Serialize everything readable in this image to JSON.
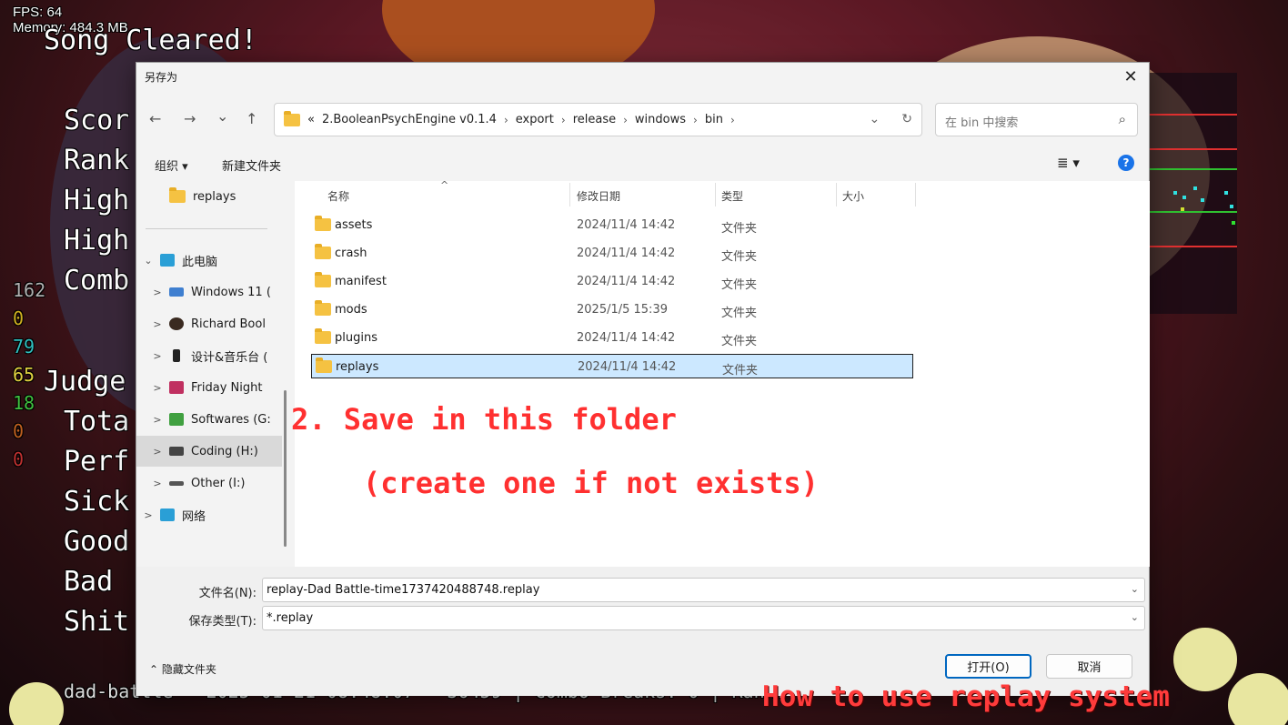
{
  "game": {
    "fps": "FPS: 64",
    "memory": "Memory: 484.3 MB",
    "song_cleared": "Song Cleared!",
    "stats": [
      "Scor",
      "Rank",
      "High",
      "High",
      "Comb"
    ],
    "numbers": [
      "162",
      "0",
      "79",
      "65",
      "18",
      "0",
      "0"
    ],
    "judge_title": "Judge",
    "judge_stats": [
      "Tota",
      "Perf",
      "Sick",
      "Good",
      "Bad",
      "Shit"
    ],
    "footer_text": "dad-battle - 2025-01-21 08:48:07 - 36459 | Combo Breaks: 0 | Rank:",
    "tutorial_title": "How to use replay system"
  },
  "dialog": {
    "title": "另存为",
    "close_label": "✕",
    "nav": {
      "back": "←",
      "forward": "→",
      "recent": "⌄",
      "up": "↑"
    },
    "breadcrumb": {
      "prefix": "«",
      "items": [
        "2.BooleanPsychEngine v0.1.4",
        "export",
        "release",
        "windows",
        "bin"
      ]
    },
    "search_placeholder": "在 bin 中搜索",
    "toolbar": {
      "organize": "组织 ▾",
      "new_folder": "新建文件夹",
      "view": "≣ ▾",
      "help": "?"
    },
    "nav_pane": [
      {
        "label": "replays",
        "icon": "folder-icon",
        "chevron": ""
      },
      {
        "label": "此电脑",
        "icon": "computer-icon",
        "chevron": "⌄"
      },
      {
        "label": "Windows 11 (",
        "icon": "drive-icon",
        "chevron": ">"
      },
      {
        "label": "Richard Bool",
        "icon": "user-avatar-icon",
        "chevron": ">"
      },
      {
        "label": "设计&音乐台 (",
        "icon": "drive-icon",
        "chevron": ">"
      },
      {
        "label": "Friday Night",
        "icon": "game-icon",
        "chevron": ">"
      },
      {
        "label": "Softwares (G:",
        "icon": "drive-icon",
        "chevron": ">"
      },
      {
        "label": "Coding (H:)",
        "icon": "drive-icon",
        "chevron": ">"
      },
      {
        "label": "Other (I:)",
        "icon": "drive-icon",
        "chevron": ">"
      },
      {
        "label": "网络",
        "icon": "network-icon",
        "chevron": ">"
      }
    ],
    "columns": {
      "name": "名称",
      "date": "修改日期",
      "type": "类型",
      "size": "大小"
    },
    "files": [
      {
        "name": "assets",
        "date": "2024/11/4 14:42",
        "type": "文件夹"
      },
      {
        "name": "crash",
        "date": "2024/11/4 14:42",
        "type": "文件夹"
      },
      {
        "name": "manifest",
        "date": "2024/11/4 14:42",
        "type": "文件夹"
      },
      {
        "name": "mods",
        "date": "2025/1/5 15:39",
        "type": "文件夹"
      },
      {
        "name": "plugins",
        "date": "2024/11/4 14:42",
        "type": "文件夹"
      },
      {
        "name": "replays",
        "date": "2024/11/4 14:42",
        "type": "文件夹"
      }
    ],
    "annotation_line1": "2. Save in this folder",
    "annotation_line2": "(create one if not exists)",
    "filename_label": "文件名(N):",
    "filename_value": "replay-Dad Battle-time1737420488748.replay",
    "filetype_label": "保存类型(T):",
    "filetype_value": "*.replay",
    "hide_folders": "⌃ 隐藏文件夹",
    "open_button": "打开(O)",
    "cancel_button": "取消"
  },
  "colors": {
    "accent": "#0067c0",
    "annotation": "#ff3030",
    "folder": "#f5c242",
    "selection": "#cce8ff"
  }
}
